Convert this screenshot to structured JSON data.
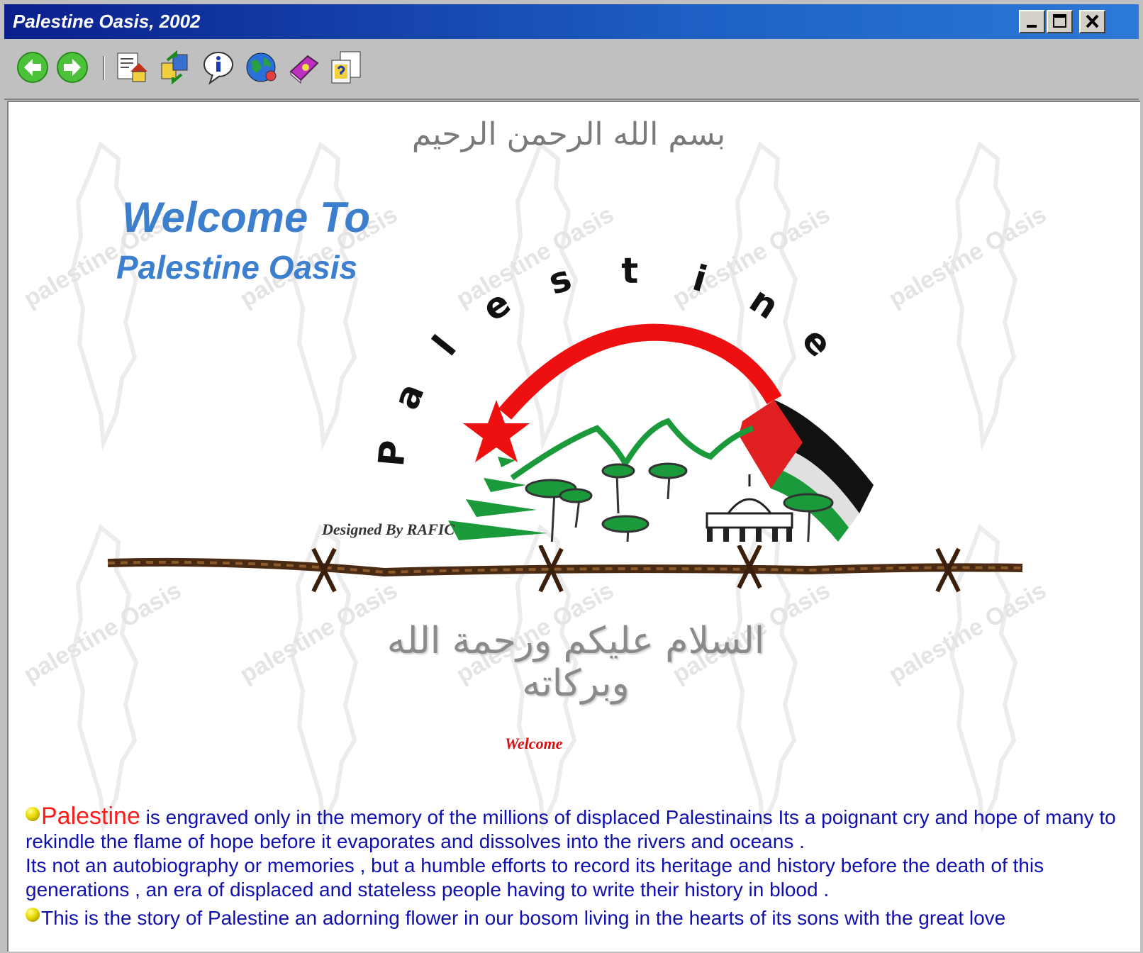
{
  "window": {
    "title": "Palestine Oasis, 2002",
    "controls": [
      "minimize",
      "maximize",
      "close"
    ]
  },
  "toolbar": {
    "buttons": [
      {
        "name": "back",
        "icon": "back-arrow-icon"
      },
      {
        "name": "forward",
        "icon": "forward-arrow-icon"
      },
      {
        "name": "home",
        "icon": "home-icon"
      },
      {
        "name": "exchange",
        "icon": "exchange-icon"
      },
      {
        "name": "info",
        "icon": "info-icon"
      },
      {
        "name": "web",
        "icon": "globe-icon"
      },
      {
        "name": "book",
        "icon": "book-icon"
      },
      {
        "name": "help",
        "icon": "help-icon"
      }
    ]
  },
  "page": {
    "bismillah": "بسم الله الرحمن الرحيم",
    "welcome_line1": "Welcome To",
    "welcome_line2": "Palestine Oasis",
    "arc_title": [
      "P",
      "a",
      "l",
      "e",
      "s",
      "t",
      "i",
      "n",
      "e"
    ],
    "watermark_text": "palestine Oasis",
    "designed_by": "Designed By RAFIC",
    "salam": "السلام عليكم ورحمة الله وبركاته",
    "welcome_small": "Welcome",
    "paragraph": {
      "highlight": "Palestine",
      "text1": " is engraved only in the memory of the millions of displaced Palestinains Its a poignant cry and hope of many to rekindle the flame of hope before it evaporates and dissolves into the rivers and oceans .",
      "text2": "Its not an autobiography or memories , but a humble efforts to record its heritage and history before the death of  this generations , an era of displaced and stateless people having to write their history in blood .",
      "text3": "This is the story  of Palestine  an adorning  flower in our  bosom   living  in the hearts of  its sons with  the great  love"
    },
    "colors": {
      "title_blue": "#3d7fcf",
      "body_text": "#1010b0",
      "accent_red": "#ff1a1a",
      "flag_green": "#1a9a3a"
    }
  }
}
